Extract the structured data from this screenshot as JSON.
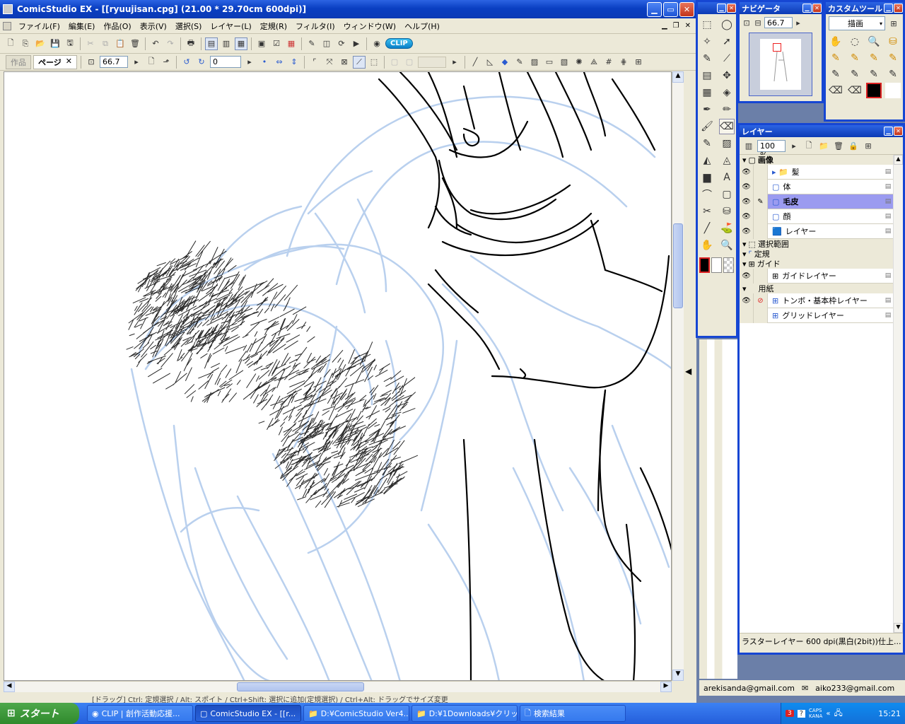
{
  "window": {
    "title": "ComicStudio EX - [[ryuujisan.cpg] (21.00 * 29.70cm 600dpi)]"
  },
  "menu": [
    "ファイル(F)",
    "編集(E)",
    "作品(O)",
    "表示(V)",
    "選択(S)",
    "レイヤー(L)",
    "定規(R)",
    "フィルタ(I)",
    "ウィンドウ(W)",
    "ヘルプ(H)"
  ],
  "toolbar": {
    "clip_label": "CLIP"
  },
  "tabs": {
    "work": "作品",
    "page": "ページ",
    "zoom": "66.7",
    "rotate": "0"
  },
  "status": {
    "hint": "[ドラッグ] Ctrl: 定規選択 / Alt: スポイト / Ctrl+Shift: 選択に追加(定規選択) / Ctrl+Alt: ドラッグでサイズ変更"
  },
  "navigator": {
    "title": "ナビゲータ",
    "zoom": "66.7"
  },
  "custom_tools": {
    "title": "カスタムツール",
    "mode": "描画"
  },
  "layers": {
    "title": "レイヤー",
    "opacity": "100 %",
    "groups": {
      "image": "画像",
      "selection": "選択範囲",
      "ruler": "定規",
      "guide": "ガイド",
      "paper": "用紙"
    },
    "items": [
      {
        "name": "髪",
        "type": "folder",
        "visible": true,
        "selected": false
      },
      {
        "name": "体",
        "type": "raster",
        "visible": true,
        "selected": false
      },
      {
        "name": "毛皮",
        "type": "raster",
        "visible": true,
        "selected": true
      },
      {
        "name": "顔",
        "type": "raster",
        "visible": true,
        "selected": false
      },
      {
        "name": "レイヤー",
        "type": "color",
        "visible": true,
        "selected": false
      }
    ],
    "guide_items": [
      {
        "name": "ガイドレイヤー"
      }
    ],
    "paper_items": [
      {
        "name": "トンボ・基本枠レイヤー"
      },
      {
        "name": "グリッドレイヤー"
      }
    ],
    "info": "ラスターレイヤー 600 dpi(黒白(2bit))仕上..."
  },
  "mail": {
    "a": "arekisanda@gmail.com",
    "b": "aiko233@gmail.com"
  },
  "taskbar": {
    "start": "スタート",
    "buttons": [
      "CLIP | 創作活動応援...",
      "ComicStudio EX - [[r...",
      "D:¥ComicStudio Ver4...",
      "D:¥1Downloads¥クリッ...",
      "検索結果"
    ],
    "clock": "15:21",
    "caps": "CAPS",
    "kana": "KANA"
  },
  "colors": {
    "xp_blue": "#0b3ab5",
    "selected_layer": "#9b9bf0",
    "sketch": "#b9d0ee"
  }
}
